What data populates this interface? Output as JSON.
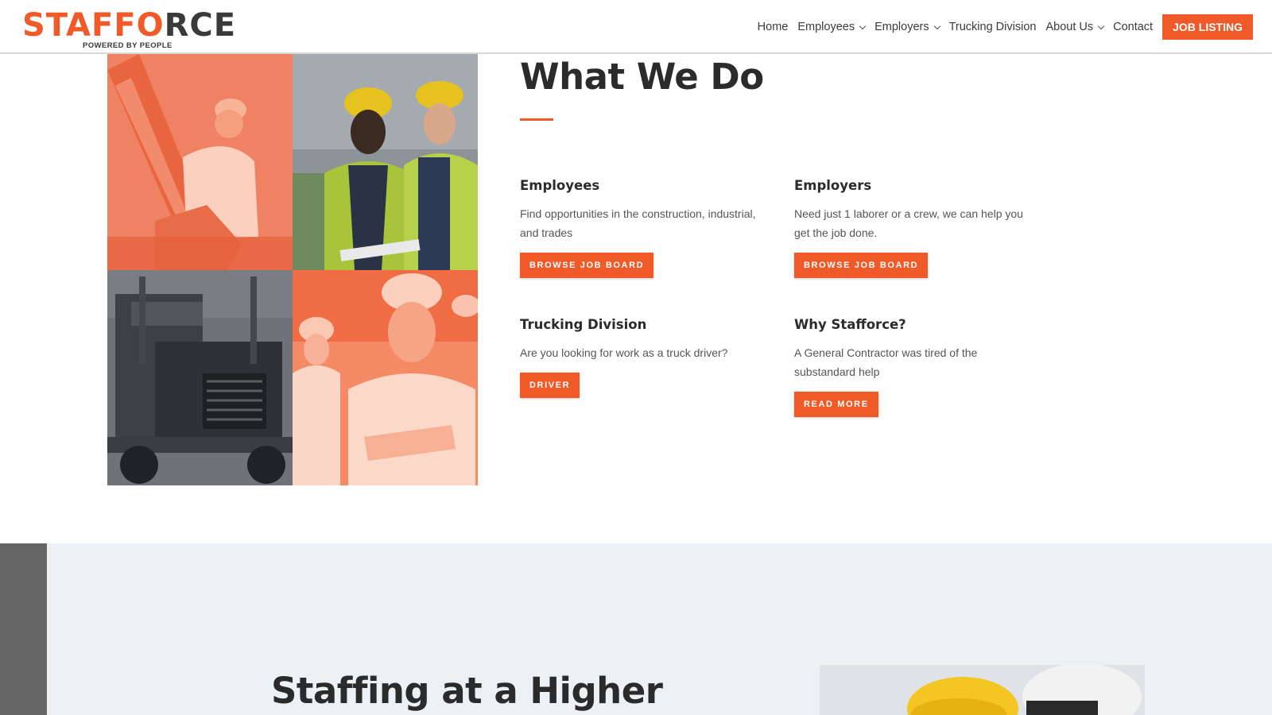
{
  "brand": {
    "logo_orange": "STAF",
    "logo_o": "F",
    "logo_fire": "O",
    "logo_dark": "RCE",
    "tagline": "POWERED BY PEOPLE",
    "accent_color": "#f05a28",
    "dark_color": "#3a3a3a"
  },
  "nav": {
    "items": [
      {
        "label": "Home",
        "has_dropdown": false
      },
      {
        "label": "Employees",
        "has_dropdown": true
      },
      {
        "label": "Employers",
        "has_dropdown": true
      },
      {
        "label": "Trucking Division",
        "has_dropdown": false
      },
      {
        "label": "About Us",
        "has_dropdown": true
      },
      {
        "label": "Contact",
        "has_dropdown": false
      }
    ],
    "cta_label": "JOB LISTING"
  },
  "what_we_do": {
    "title": "What We Do",
    "cards": [
      {
        "title": "Employees",
        "text": "Find opportunities in the construction, industrial, and trades",
        "button": "BROWSE JOB BOARD"
      },
      {
        "title": "Employers",
        "text": "Need just 1 laborer or a crew, we can help you get the job done.",
        "button": "BROWSE JOB BOARD"
      },
      {
        "title": "Trucking Division",
        "text": "Are you looking for work as a truck driver?",
        "button": "DRIVER"
      },
      {
        "title": "Why Stafforce?",
        "text": "A General Contractor was tired of the substandard help",
        "button": "READ MORE"
      }
    ]
  },
  "bottom_section": {
    "title": "Staffing at a Higher"
  }
}
